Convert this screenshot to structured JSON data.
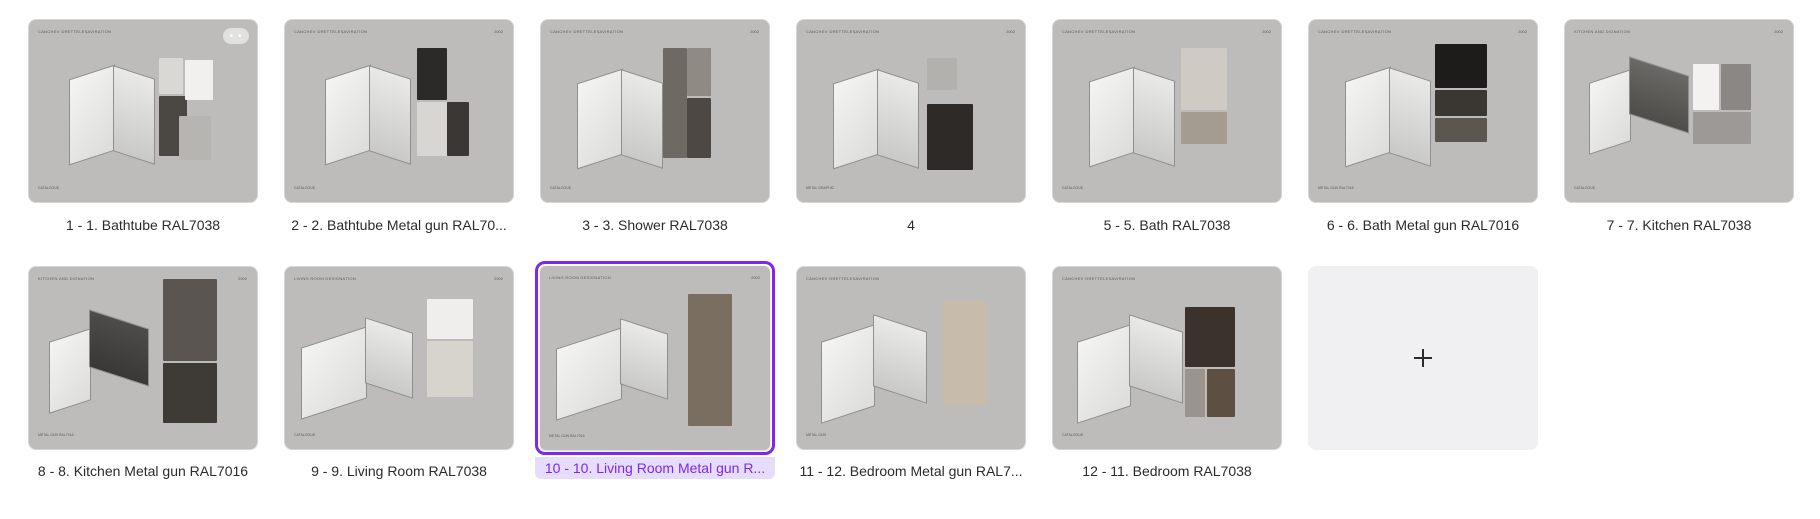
{
  "pages": [
    {
      "caption": "1 - 1. Bathtube RAL7038",
      "sheet_title": "CANCHEV GRETTELESAVIRATION",
      "sheet_num": "",
      "foot": "CATALOGUE"
    },
    {
      "caption": "2 - 2. Bathtube Metal gun RAL70...",
      "sheet_title": "CANCHEV GRETTELESAVIRATION",
      "sheet_num": "2002",
      "foot": "CATALOGUE"
    },
    {
      "caption": "3 - 3. Shower RAL7038",
      "sheet_title": "CANCHEV GRETTELESAVIRATION",
      "sheet_num": "2002",
      "foot": "CATALOGUE"
    },
    {
      "caption": "4",
      "sheet_title": "CANCHEV GRETTELESAVIRATION",
      "sheet_num": "2002",
      "foot": "METAL GRAPHIC"
    },
    {
      "caption": "5 - 5. Bath RAL7038",
      "sheet_title": "CANCHEV GRETTELESAVIRATION",
      "sheet_num": "2002",
      "foot": "CATALOGUE"
    },
    {
      "caption": "6 - 6. Bath Metal gun RAL7016",
      "sheet_title": "CANCHEV GRETTELESAVIRATION",
      "sheet_num": "2002",
      "foot": "METAL GUN RAL7016"
    },
    {
      "caption": "7 - 7. Kitchen RAL7038",
      "sheet_title": "KITCHEN AND DIGNATION",
      "sheet_num": "2002",
      "foot": "CATALOGUE"
    },
    {
      "caption": "8 - 8. Kitchen Metal gun RAL7016",
      "sheet_title": "KITCHEN AND DIGNATION",
      "sheet_num": "2002",
      "foot": "METAL GUN RAL7016"
    },
    {
      "caption": "9 - 9. Living Room RAL7038",
      "sheet_title": "LIVING ROOM DESIGNATION",
      "sheet_num": "2002",
      "foot": "CATALOGUE"
    },
    {
      "caption": "10 - 10. Living Room Metal gun R...",
      "sheet_title": "LIVING ROOM DESIGNATION",
      "sheet_num": "2002",
      "foot": "METAL GUN RAL7016"
    },
    {
      "caption": "11 - 12. Bedroom Metal gun RAL7...",
      "sheet_title": "CANCHEV GRETTELESAVIRATION",
      "sheet_num": "",
      "foot": "METAL GUN"
    },
    {
      "caption": "12 - 11. Bedroom RAL7038",
      "sheet_title": "CANCHEV GRETTELESAVIRATION",
      "sheet_num": "",
      "foot": "CATALOGUE"
    }
  ],
  "add_page": {
    "icon": "plus-icon"
  },
  "selected_index": 10,
  "colors": {
    "accent": "#7d2ae8",
    "accent_bg": "#e6dcfb",
    "thumb_bg": "#bdbcba",
    "add_bg": "#f0f0f2"
  }
}
